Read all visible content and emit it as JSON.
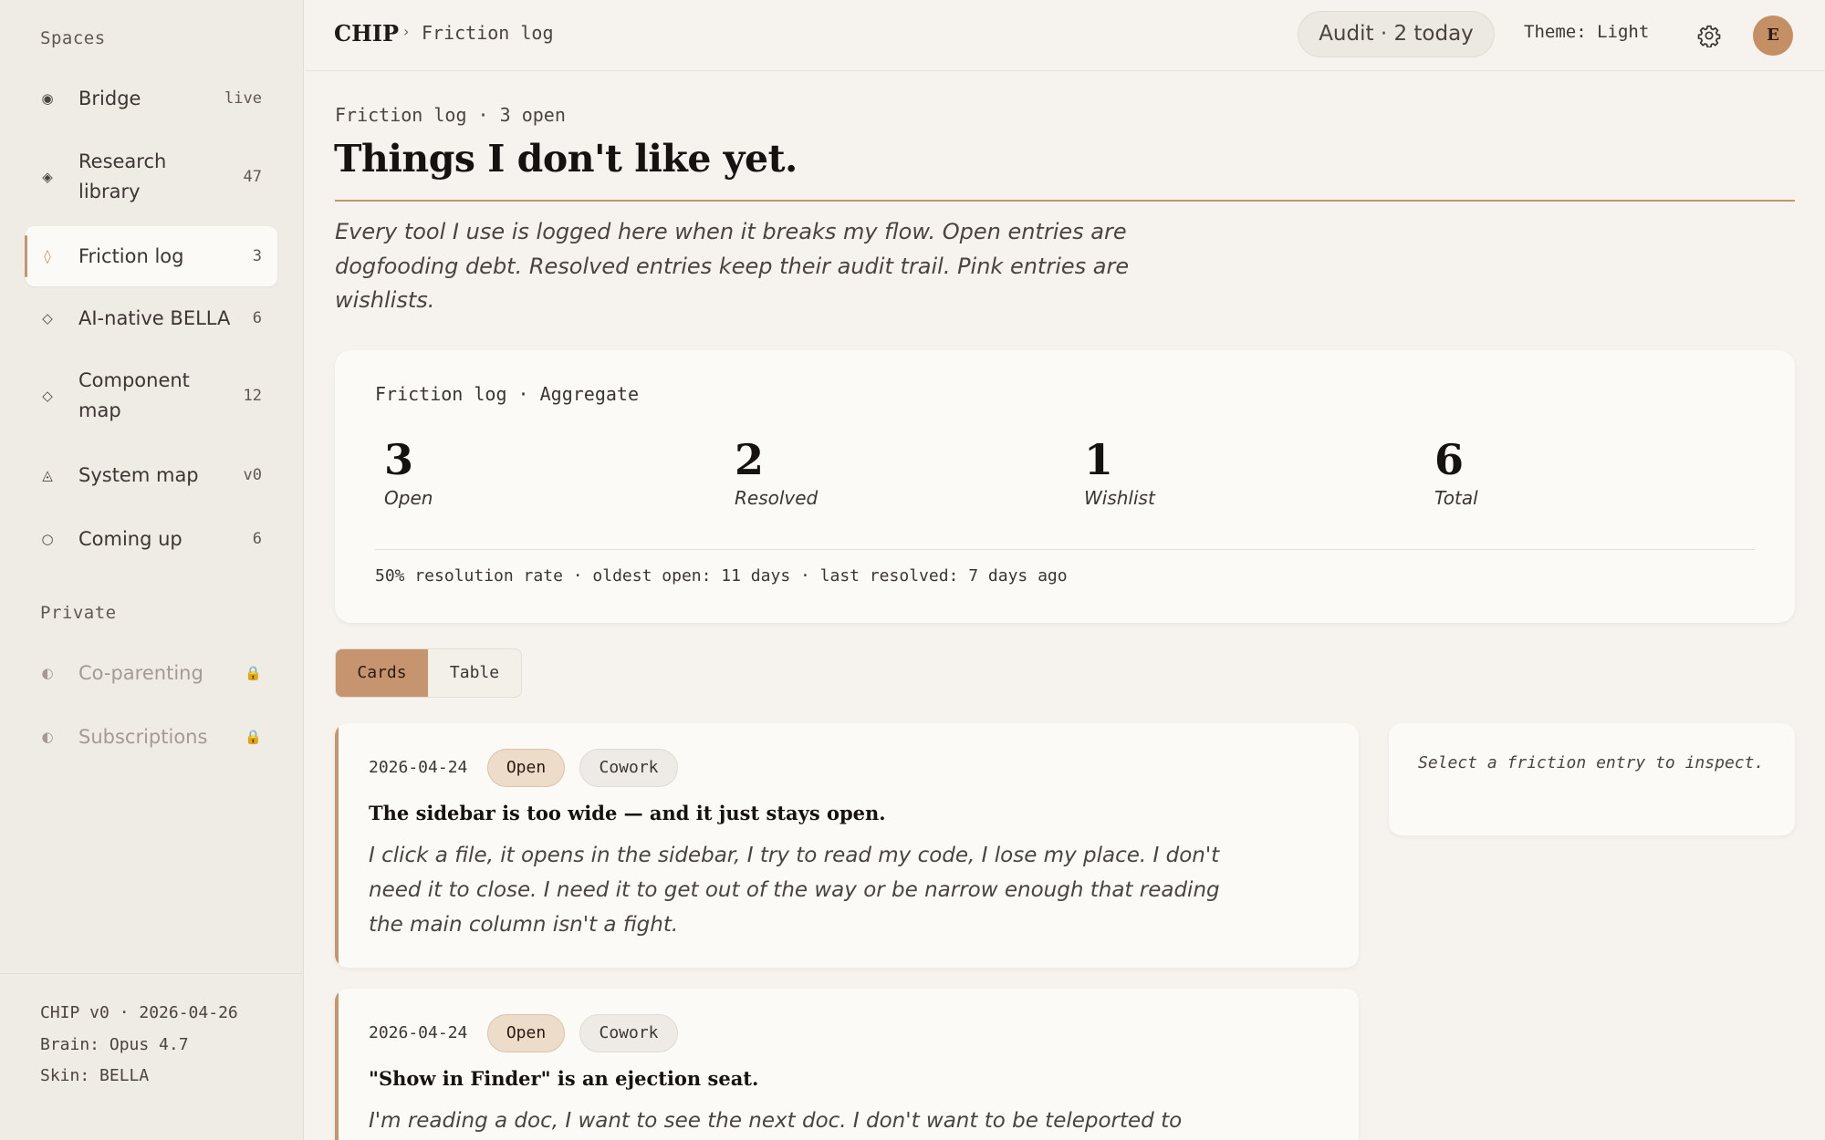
{
  "sidebar": {
    "spaces_heading": "Spaces",
    "items": [
      {
        "icon": "◉",
        "icon_name": "bullseye-icon",
        "label": "Bridge",
        "count": "live"
      },
      {
        "icon": "◈",
        "icon_name": "diamond-dot-icon",
        "label": "Research library",
        "count": "47"
      },
      {
        "icon": "◊",
        "icon_name": "lozenge-icon",
        "label": "Friction log",
        "count": "3"
      },
      {
        "icon": "◇",
        "icon_name": "diamond-outline-icon",
        "label": "AI-native BELLA",
        "count": "6"
      },
      {
        "icon": "◇",
        "icon_name": "diamond-outline-icon",
        "label": "Component map",
        "count": "12"
      },
      {
        "icon": "◬",
        "icon_name": "triangle-dot-icon",
        "label": "System map",
        "count": "v0"
      },
      {
        "icon": "○",
        "icon_name": "circle-outline-icon",
        "label": "Coming up",
        "count": "6"
      }
    ],
    "private_heading": "Private",
    "private_items": [
      {
        "icon": "◐",
        "icon_name": "half-circle-icon",
        "label": "Co-parenting",
        "lock": "🔒"
      },
      {
        "icon": "◐",
        "icon_name": "half-circle-icon",
        "label": "Subscriptions",
        "lock": "🔒"
      }
    ],
    "footer": {
      "version": "CHIP v0 · 2026-04-26",
      "brain": "Brain: Opus 4.7",
      "skin": "Skin: BELLA"
    }
  },
  "header": {
    "brand": "CHIP",
    "crumb_separator": "›",
    "crumb": "Friction log",
    "audit": "Audit · 2 today",
    "theme": "Theme: Light",
    "avatar_initial": "E"
  },
  "main": {
    "eyebrow": "Friction log · 3 open",
    "title": "Things I don't like yet.",
    "intro": "Every tool I use is logged here when it breaks my flow. Open entries are dogfooding debt. Resolved entries keep their audit trail. Pink entries are wishlists.",
    "aggregate": {
      "label": "Friction log · Aggregate",
      "stats": [
        {
          "value": "3",
          "caption": "Open"
        },
        {
          "value": "2",
          "caption": "Resolved"
        },
        {
          "value": "1",
          "caption": "Wishlist"
        },
        {
          "value": "6",
          "caption": "Total"
        }
      ],
      "footer": "50% resolution rate · oldest open: 11 days · last resolved: 7 days ago"
    },
    "view_toggle": {
      "cards": "Cards",
      "table": "Table",
      "selected": "Cards"
    },
    "entries": [
      {
        "date": "2026-04-24",
        "status": "Open",
        "tag": "Cowork",
        "title": "The sidebar is too wide — and it just stays open.",
        "body": "I click a file, it opens in the sidebar, I try to read my code, I lose my place. I don't need it to close. I need it to get out of the way or be narrow enough that reading the main column isn't a fight."
      },
      {
        "date": "2026-04-24",
        "status": "Open",
        "tag": "Cowork",
        "title": "\"Show in Finder\" is an ejection seat.",
        "body": "I'm reading a doc, I want to see the next doc. I don't want to be teleported to"
      }
    ],
    "inspector_placeholder": "Select a friction entry to inspect."
  },
  "colors": {
    "accent": "#c69570",
    "background": "#f6f3ee",
    "sidebar": "#efebe5",
    "card": "#fbfaf7"
  }
}
